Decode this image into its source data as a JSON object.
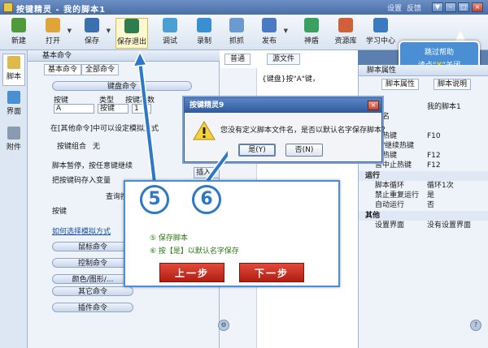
{
  "app": {
    "title": "按键精灵 - 我的脚本1",
    "menu": [
      "设置",
      "反馈"
    ],
    "window_buttons": [
      "▼",
      "–",
      "□",
      "×"
    ]
  },
  "toolbar": {
    "items": [
      {
        "label": "新建",
        "icon": "new-icon",
        "color": "#4f9a3a"
      },
      {
        "label": "打开",
        "icon": "open-icon",
        "color": "#e0a53a"
      },
      {
        "label": "保存",
        "icon": "save-icon",
        "color": "#3a6fb0"
      },
      {
        "label": "保存退出",
        "icon": "save-exit-icon",
        "color": "#2e7d4f"
      },
      {
        "label": "调试",
        "icon": "debug-icon",
        "color": "#4aa0d0"
      },
      {
        "label": "录制",
        "icon": "record-icon",
        "color": "#3a8fd0"
      },
      {
        "label": "抓抓",
        "icon": "capture-icon",
        "color": "#6a9ad0"
      },
      {
        "label": "发布",
        "icon": "publish-icon",
        "color": "#4a7ac0"
      },
      {
        "label": "神盾",
        "icon": "shield-icon",
        "color": "#3aa060"
      },
      {
        "label": "资源库",
        "icon": "library-icon",
        "color": "#d0603a"
      },
      {
        "label": "学习中心",
        "icon": "learning-icon",
        "color": "#3a7ac0"
      }
    ]
  },
  "tooltip": {
    "line1": "跳过帮助",
    "line2_prefix": "请点“",
    "line2_x": "X",
    "line2_suffix": "”关闭"
  },
  "left_tabs": [
    {
      "label": "脚本",
      "icon": "script-icon"
    },
    {
      "label": "界面",
      "icon": "interface-icon"
    },
    {
      "label": "附件",
      "icon": "attachment-icon"
    }
  ],
  "command_panel": {
    "title": "基本命令",
    "tabs": [
      "基本命令",
      "全部命令"
    ],
    "keyboard_section": "键盘命令",
    "col_key": "按键",
    "col_type": "类型",
    "col_count": "按键次数",
    "key_value": "A",
    "type_value": "按键",
    "count_value": "1",
    "insert_label": "插入",
    "insert_arrow_label": "插入→",
    "hint1": "在[其他命令]中可以设定模拟方式",
    "combo_label": "按键组合",
    "combo_value": "无",
    "pause_label": "脚本暂停，按任意键继续",
    "store_label": "把按键码存入变量",
    "query_label": "查询按",
    "key_label": "按键",
    "simulation_link": "如何选择模拟方式",
    "sections": [
      "鼠标命令",
      "控制命令",
      "颜色/图形/...",
      "其它命令",
      "插件命令"
    ]
  },
  "editor": {
    "tabs": [
      "普通",
      "源文件"
    ],
    "line1": "{键盘}按\"A\"键，"
  },
  "properties": {
    "title": "脚本属性",
    "tabs": [
      "脚本属性",
      "脚本说明"
    ],
    "rows": [
      {
        "k": "类",
        "v": "我的脚本1",
        "cat": false
      },
      {
        "k": "本名",
        "v": "",
        "cat": false
      },
      {
        "k": "键",
        "v": "",
        "cat": false
      },
      {
        "k": "动热键",
        "v": "F10",
        "cat": false
      },
      {
        "k": "停/继续热键",
        "v": "",
        "cat": false
      },
      {
        "k": "止热键",
        "v": "F12",
        "cat": false
      },
      {
        "k": "暂中止热键",
        "v": "F12",
        "cat": false
      },
      {
        "k": "运行",
        "v": "",
        "cat": true
      },
      {
        "k": "脚本循环",
        "v": "循环1次",
        "cat": false
      },
      {
        "k": "禁止重复运行",
        "v": "是",
        "cat": false
      },
      {
        "k": "自动运行",
        "v": "否",
        "cat": false
      },
      {
        "k": "其他",
        "v": "",
        "cat": true
      },
      {
        "k": "设置界面",
        "v": "没有设置界面",
        "cat": false
      }
    ]
  },
  "dialog": {
    "title": "按键精灵9",
    "message": "您没有定义脚本文件名，是否以默认名字保存脚本？",
    "yes_label": "是(Y)",
    "no_label": "否(N)",
    "close_label": "×"
  },
  "tutorial": {
    "step5_number": "5",
    "step6_number": "6",
    "step5_text": "⑤ 保存脚本",
    "step6_text": "⑥ 按【是】以默认名字保存",
    "prev_label": "上一步",
    "next_label": "下一步"
  },
  "colors": {
    "accent": "#2d78c8",
    "button_red": "#c42a1c",
    "tooltip_blue": "#4a8fd3"
  }
}
